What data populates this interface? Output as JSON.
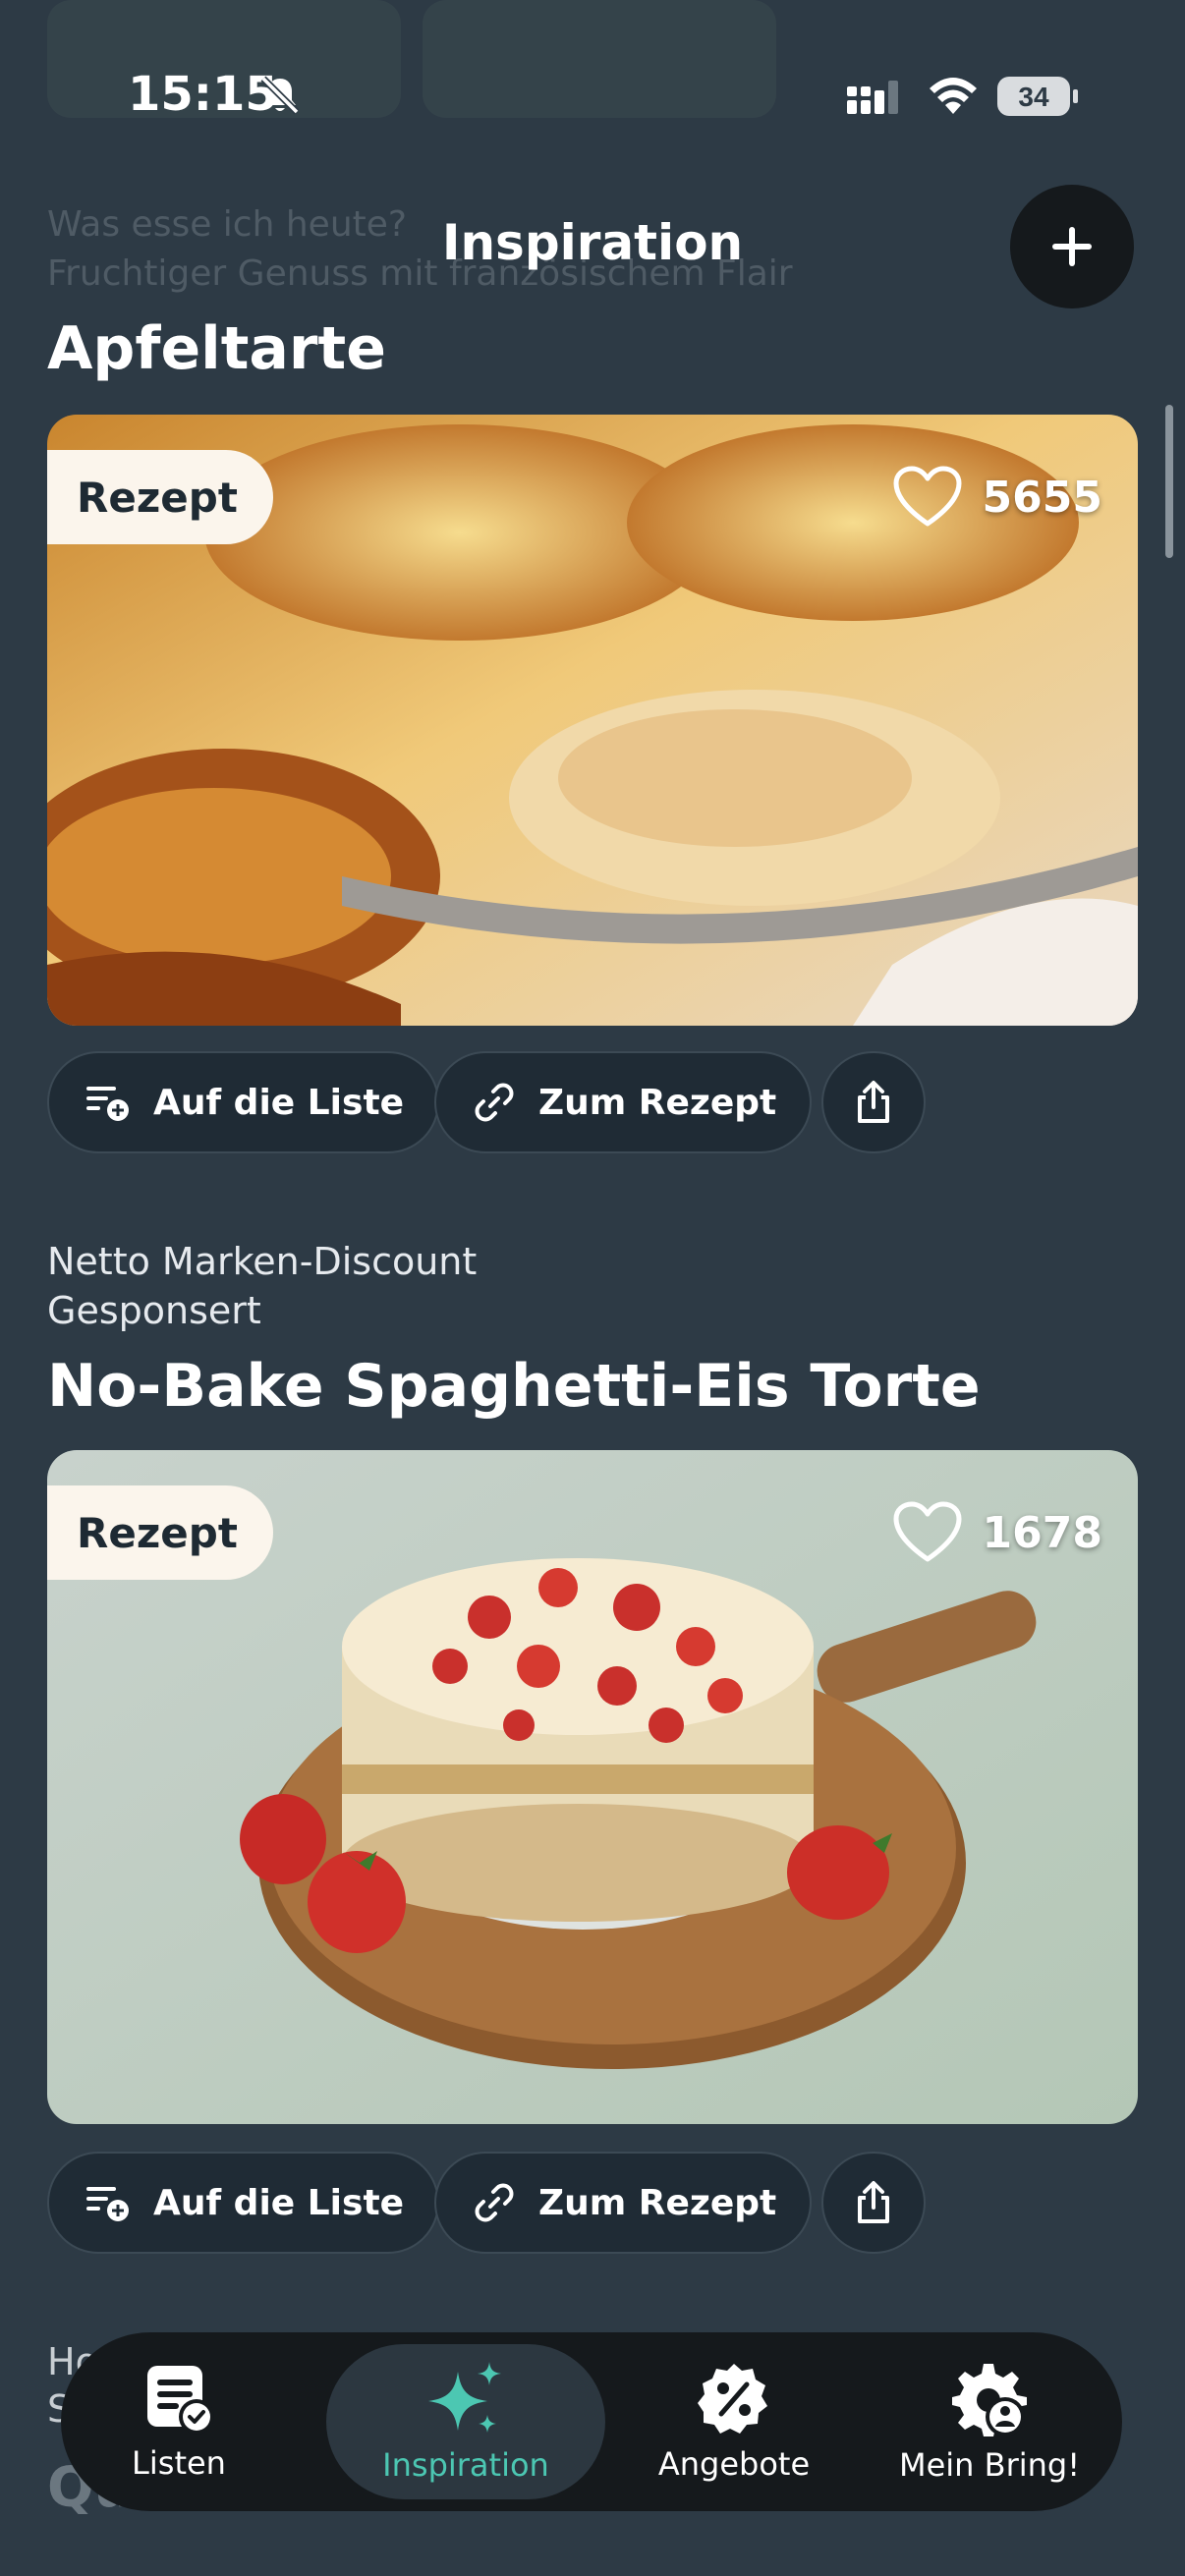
{
  "status_bar": {
    "time": "15:15",
    "battery": "34"
  },
  "background_peek": {
    "line1": "Was esse ich heute?",
    "line2": "Fruchtiger Genuss mit französischem Flair"
  },
  "header": {
    "title": "Inspiration"
  },
  "cards": [
    {
      "title": "Apfeltarte",
      "badge": "Rezept",
      "likes": "5655",
      "actions": {
        "add": "Auf die Liste",
        "recipe": "Zum Rezept"
      }
    },
    {
      "sponsor": "Netto Marken-Discount",
      "sponsored_label": "Gesponsert",
      "title": "No-Bake Spaghetti-Eis Torte",
      "badge": "Rezept",
      "likes": "1678",
      "actions": {
        "add": "Auf die Liste",
        "recipe": "Zum Rezept"
      }
    }
  ],
  "bottom_peek": {
    "l1": "Ho",
    "l2": "S",
    "l3": "Qu"
  },
  "tabbar": {
    "tabs": [
      {
        "label": "Listen",
        "icon": "list-check-icon"
      },
      {
        "label": "Inspiration",
        "icon": "sparkles-icon",
        "active": true
      },
      {
        "label": "Angebote",
        "icon": "percent-badge-icon"
      },
      {
        "label": "Mein Bring!",
        "icon": "gear-user-icon"
      }
    ]
  },
  "colors": {
    "background": "#2d3a45",
    "accent": "#4cc7b2",
    "tabbar": "#15191c",
    "badge": "#fbf5ec"
  }
}
